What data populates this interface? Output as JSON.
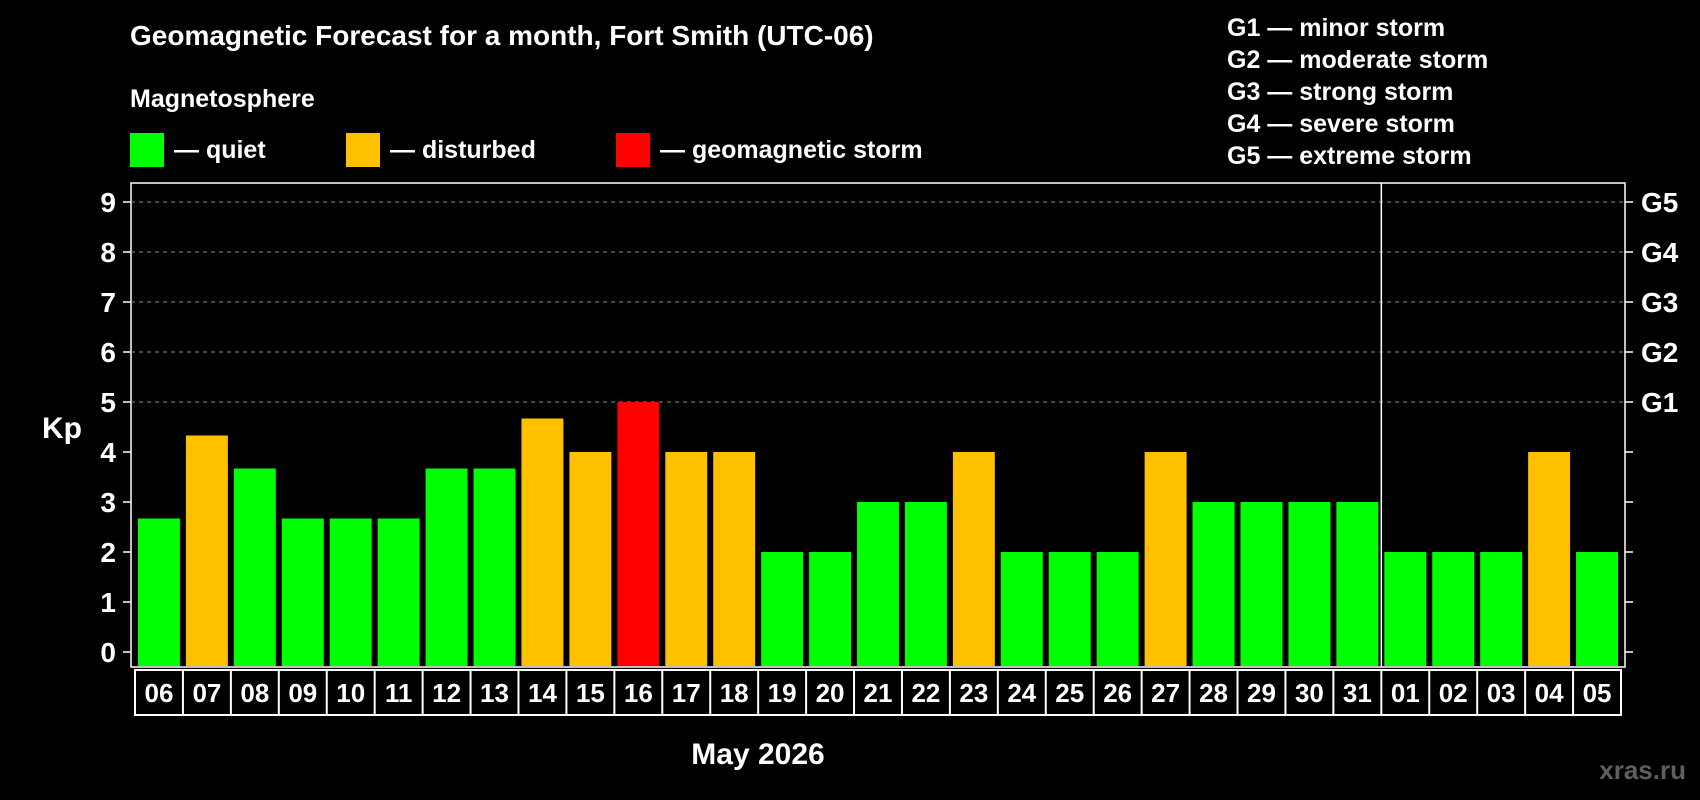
{
  "header": {
    "title": "Geomagnetic Forecast for a month, Fort Smith (UTC-06)",
    "magnetosphere_label": "Magnetosphere"
  },
  "legend": [
    {
      "label": "— quiet",
      "color": "#00ff00"
    },
    {
      "label": "— disturbed",
      "color": "#ffc000"
    },
    {
      "label": "— geomagnetic storm",
      "color": "#ff0000"
    }
  ],
  "storm_scale": [
    "G1 — minor storm",
    "G2 — moderate storm",
    "G3 — strong storm",
    "G4 — severe storm",
    "G5 — extreme storm"
  ],
  "watermark": "xras.ru",
  "chart_data": {
    "type": "bar",
    "title": "Geomagnetic Forecast for a month, Fort Smith (UTC-06)",
    "xlabel": "May 2026",
    "ylabel": "Kp",
    "ylim": [
      0,
      9
    ],
    "yticks": [
      0,
      1,
      2,
      3,
      4,
      5,
      6,
      7,
      8,
      9
    ],
    "right_axis_labels": [
      {
        "kp": 5,
        "label": "G1"
      },
      {
        "kp": 6,
        "label": "G2"
      },
      {
        "kp": 7,
        "label": "G3"
      },
      {
        "kp": 8,
        "label": "G4"
      },
      {
        "kp": 9,
        "label": "G5"
      }
    ],
    "month_divider_after": "31",
    "categories": [
      "06",
      "07",
      "08",
      "09",
      "10",
      "11",
      "12",
      "13",
      "14",
      "15",
      "16",
      "17",
      "18",
      "19",
      "20",
      "21",
      "22",
      "23",
      "24",
      "25",
      "26",
      "27",
      "28",
      "29",
      "30",
      "31",
      "01",
      "02",
      "03",
      "04",
      "05"
    ],
    "values": [
      2.67,
      4.33,
      3.67,
      2.67,
      2.67,
      2.67,
      3.67,
      3.67,
      4.67,
      4,
      5,
      4,
      4,
      2,
      2,
      3,
      3,
      4,
      2,
      2,
      2,
      4,
      3,
      3,
      3,
      3,
      2,
      2,
      2,
      4,
      2
    ],
    "colors": {
      "quiet": "#00ff00",
      "disturbed": "#ffc000",
      "storm": "#ff0000"
    },
    "grid": true,
    "legend": "top"
  }
}
